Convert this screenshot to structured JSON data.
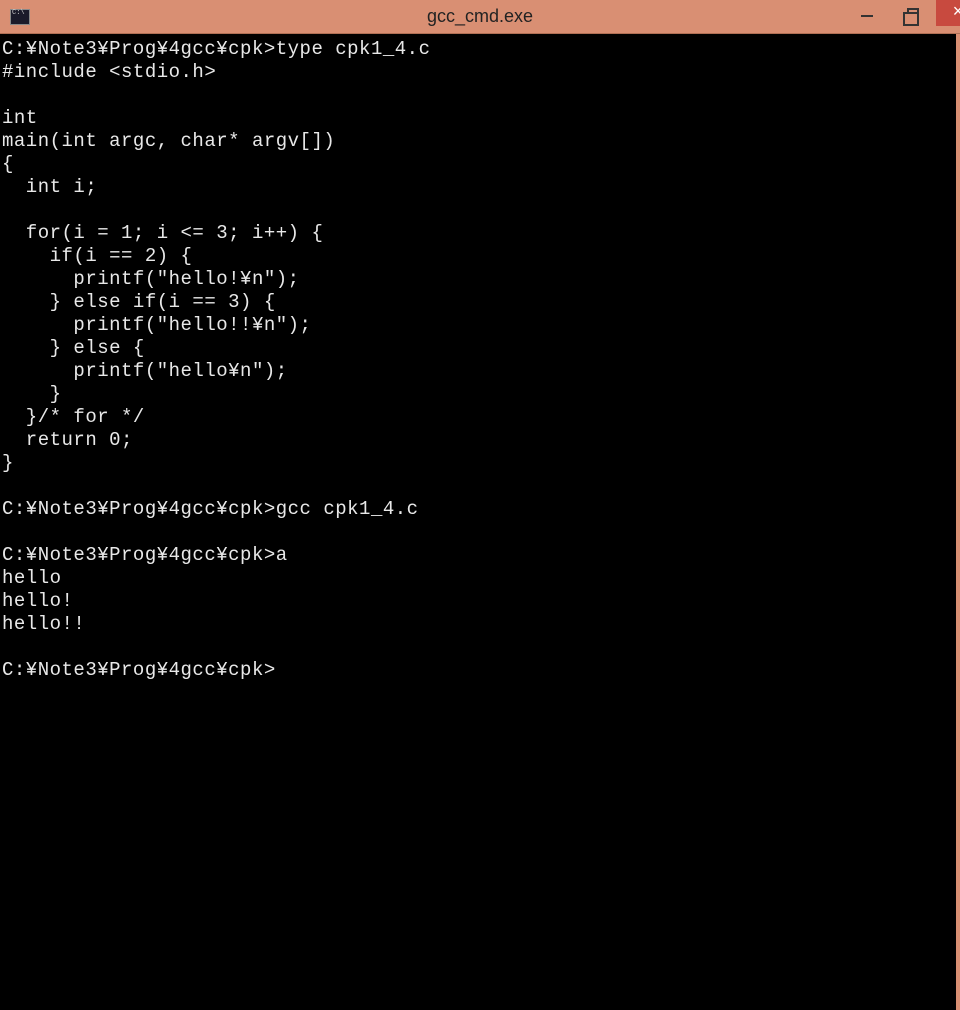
{
  "window": {
    "title": "gcc_cmd.exe"
  },
  "terminal": {
    "lines": [
      "C:¥Note3¥Prog¥4gcc¥cpk>type cpk1_4.c",
      "#include <stdio.h>",
      "",
      "int",
      "main(int argc, char* argv[])",
      "{",
      "  int i;",
      "",
      "  for(i = 1; i <= 3; i++) {",
      "    if(i == 2) {",
      "      printf(\"hello!¥n\");",
      "    } else if(i == 3) {",
      "      printf(\"hello!!¥n\");",
      "    } else {",
      "      printf(\"hello¥n\");",
      "    }",
      "  }/* for */",
      "  return 0;",
      "}",
      "",
      "C:¥Note3¥Prog¥4gcc¥cpk>gcc cpk1_4.c",
      "",
      "C:¥Note3¥Prog¥4gcc¥cpk>a",
      "hello",
      "hello!",
      "hello!!",
      "",
      "C:¥Note3¥Prog¥4gcc¥cpk>"
    ]
  }
}
